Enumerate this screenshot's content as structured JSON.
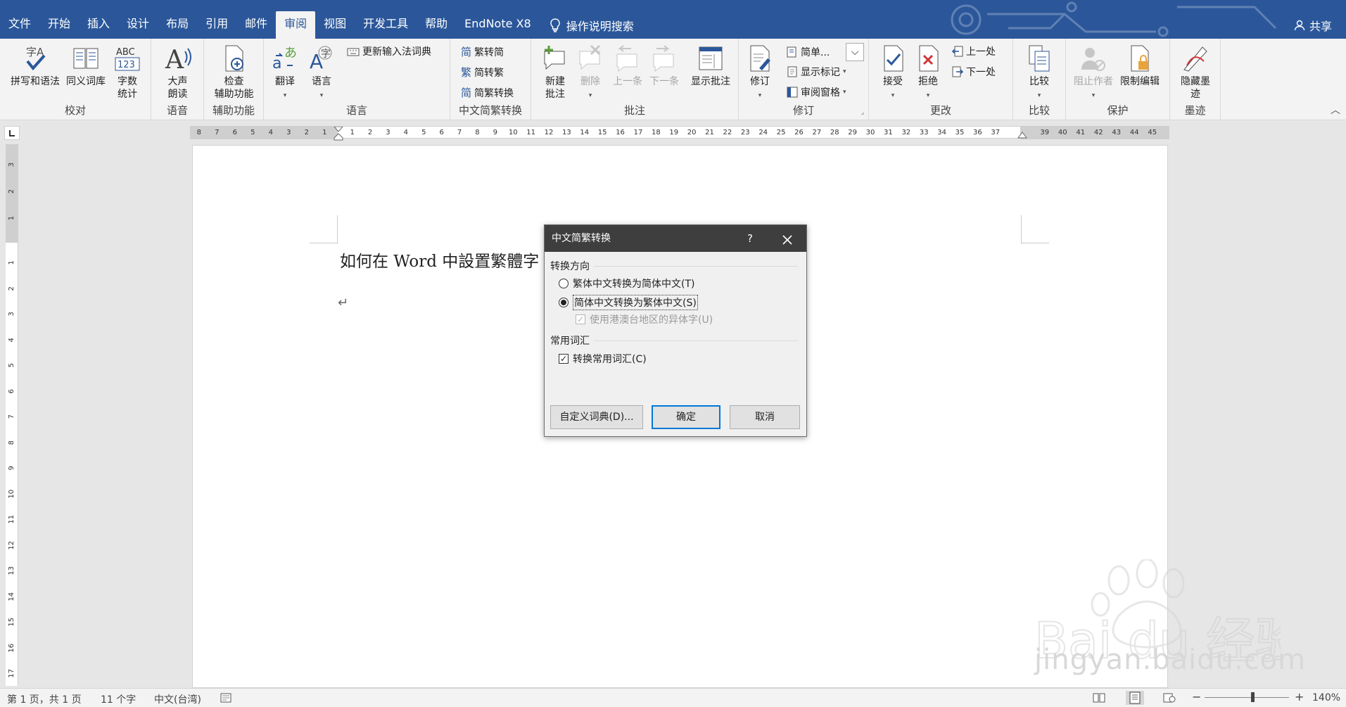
{
  "tabs": [
    "文件",
    "开始",
    "插入",
    "设计",
    "布局",
    "引用",
    "邮件",
    "审阅",
    "视图",
    "开发工具",
    "帮助",
    "EndNote X8"
  ],
  "active_tab": "审阅",
  "tell_me": "操作说明搜索",
  "share": "共享",
  "ribbon": {
    "proofing": {
      "label": "校对",
      "spelling": "拼写和语法",
      "thesaurus": "同义词库",
      "wordcount_1": "字数",
      "wordcount_2": "统计"
    },
    "speech": {
      "label": "语音",
      "readaloud_1": "大声",
      "readaloud_2": "朗读"
    },
    "accessibility": {
      "label": "辅助功能",
      "check_1": "检查",
      "check_2": "辅助功能"
    },
    "language": {
      "label": "语言",
      "translate": "翻译",
      "language": "语言",
      "update_ime": "更新输入法词典"
    },
    "chinese": {
      "label": "中文简繁转换",
      "to_simplified": "繁转简",
      "to_traditional": "简转繁",
      "convert": "简繁转换"
    },
    "comments": {
      "label": "批注",
      "new_1": "新建",
      "new_2": "批注",
      "delete": "删除",
      "prev": "上一条",
      "next": "下一条",
      "show": "显示批注"
    },
    "tracking": {
      "label": "修订",
      "track": "修订",
      "markup_select": "简单...",
      "show_markup": "显示标记",
      "review_pane": "审阅窗格"
    },
    "changes": {
      "label": "更改",
      "accept": "接受",
      "reject": "拒绝",
      "prev": "上一处",
      "next": "下一处"
    },
    "compare": {
      "label": "比较",
      "compare": "比较"
    },
    "protect": {
      "label": "保护",
      "block_authors": "阻止作者",
      "restrict": "限制编辑"
    },
    "ink": {
      "label": "墨迹",
      "hide_1": "隐藏墨",
      "hide_2": "迹"
    }
  },
  "ruler": {
    "h_left": [
      "8",
      "7",
      "6",
      "5",
      "4",
      "3",
      "2",
      "1"
    ],
    "h_right": [
      "1",
      "2",
      "3",
      "4",
      "5",
      "6",
      "7",
      "8",
      "9",
      "10",
      "11",
      "12",
      "13",
      "14",
      "15",
      "16",
      "17",
      "18",
      "19",
      "20",
      "21",
      "22",
      "23",
      "24",
      "25",
      "26",
      "27",
      "28",
      "29",
      "30",
      "31",
      "32",
      "33",
      "34",
      "35",
      "36",
      "37"
    ],
    "h_margin": [
      "39",
      "40",
      "41",
      "42",
      "43",
      "44",
      "45"
    ],
    "v_top": [
      "3",
      "2",
      "1"
    ],
    "v_body": [
      "1",
      "2",
      "3",
      "4",
      "5",
      "6",
      "7",
      "8",
      "9",
      "10",
      "11",
      "12",
      "13",
      "14",
      "15",
      "16",
      "17"
    ]
  },
  "document": {
    "text": "如何在 Word 中設置繁體字",
    "pilcrow": "↵"
  },
  "dialog": {
    "title": "中文简繁转换",
    "help": "?",
    "section_direction": "转换方向",
    "opt_trad_to_simp": "繁体中文转换为简体中文(T)",
    "opt_simp_to_trad": "简体中文转换为繁体中文(S)",
    "opt_hk_variants": "使用港澳台地区的异体字(U)",
    "section_vocab": "常用词汇",
    "opt_convert_common": "转换常用词汇(C)",
    "btn_custom_dict": "自定义词典(D)...",
    "btn_ok": "确定",
    "btn_cancel": "取消"
  },
  "status": {
    "page": "第 1 页，共 1 页",
    "words": "11 个字",
    "language": "中文(台湾)",
    "zoom": "140%",
    "zoom_minus": "−",
    "zoom_plus": "+"
  },
  "watermark": {
    "brand": "Bai du 经验",
    "url": "jingyan.baidu.com"
  },
  "colors": {
    "accent": "#2b579a",
    "dialog_title": "#3e3e3e",
    "default_button": "#0078d7"
  }
}
